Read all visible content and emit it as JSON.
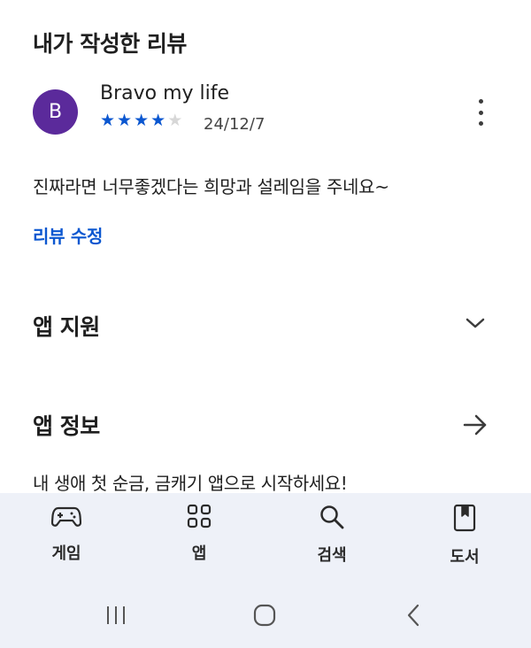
{
  "reviews_section": {
    "title": "내가 작성한 리뷰"
  },
  "review": {
    "avatar_letter": "B",
    "avatar_color": "#5b2a9b",
    "author": "Bravo my life",
    "rating": 4,
    "rating_max": 5,
    "date": "24/12/7",
    "text": "진짜라면 너무좋겠다는 희망과 설레임을 주네요~",
    "edit_label": "리뷰 수정",
    "more_icon": "more-vert-icon"
  },
  "app_support": {
    "title": "앱 지원",
    "icon": "chevron-down-icon"
  },
  "app_info": {
    "title": "앱 정보",
    "icon": "arrow-right-icon",
    "subtitle": "내 생애 첫 순금, 금캐기 앱으로 시작하세요!"
  },
  "bottom_nav": {
    "items": [
      {
        "label": "게임",
        "icon": "gamepad-icon"
      },
      {
        "label": "앱",
        "icon": "apps-grid-icon"
      },
      {
        "label": "검색",
        "icon": "search-icon"
      },
      {
        "label": "도서",
        "icon": "book-icon"
      }
    ]
  },
  "system_nav": {
    "icons": [
      "recent-apps-icon",
      "home-icon",
      "back-icon"
    ]
  },
  "colors": {
    "accent": "#0b57d0",
    "nav_bg": "#eef1f8"
  }
}
